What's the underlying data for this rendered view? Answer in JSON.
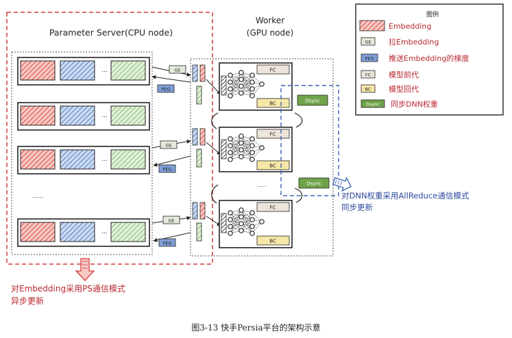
{
  "ps": {
    "title": "Parameter Server(CPU node)",
    "ellipsis_items": "...",
    "ellipsis_rows": "......"
  },
  "worker": {
    "title_line1": "Worker",
    "title_line2": "(GPU node)",
    "ellipsis_workers": "......"
  },
  "tags": {
    "ge": "GE",
    "peg": "PEG",
    "fc": "FC",
    "bc": "BC",
    "dsync": "Dsync"
  },
  "legend": {
    "title": "图例",
    "items": [
      {
        "tag": "",
        "label": "Embedding"
      },
      {
        "tag": "GE",
        "label": "拉Embedding"
      },
      {
        "tag": "PEG",
        "label": "推送Embedding的梯度"
      },
      {
        "tag": "FC",
        "label": "模型前代"
      },
      {
        "tag": "BC",
        "label": "模型回代"
      },
      {
        "tag": "Dsync",
        "label": "同步DNN权重"
      }
    ]
  },
  "annotations": {
    "ps_line1": "对Embedding采用PS通信模式",
    "ps_line2": "异步更新",
    "dnn_line1": "对DNN权重采用AllReduce通信模式",
    "dnn_line2": "同步更新"
  },
  "caption": "图3-13 快手Persia平台的架构示意",
  "colors": {
    "red_dashed": "#d23a3a",
    "blue_dashed": "#3b5fb0",
    "red_text": "#b8282e",
    "blue_text": "#2e4a9e",
    "embedding_red": "#e2524a",
    "embedding_blue": "#5b86c9",
    "embedding_green": "#8fc47f",
    "ge_fill": "#e4ebdc",
    "peg_fill": "#7f9ed6",
    "fc_fill": "#ece4da",
    "bc_fill": "#f6e7a8",
    "dsync_fill": "#6fa34a"
  }
}
